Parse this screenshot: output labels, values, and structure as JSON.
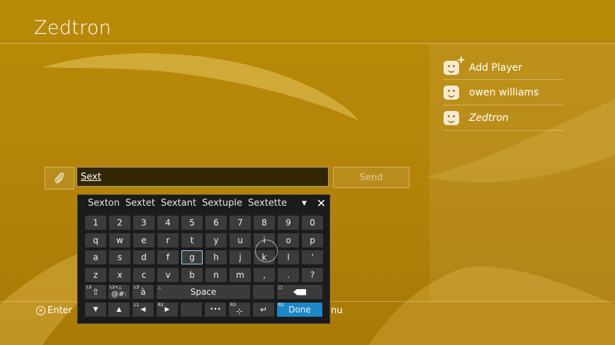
{
  "header": {
    "title": "Zedtron"
  },
  "players": [
    {
      "label": "Add Player",
      "icon": "add-player-icon",
      "italic": false
    },
    {
      "label": "owen williams",
      "icon": "user-face-icon",
      "italic": false
    },
    {
      "label": "Zedtron",
      "icon": "user-face-icon",
      "italic": true
    }
  ],
  "compose": {
    "input_value": "Sext",
    "send_label": "Send",
    "attach_icon": "paperclip-icon"
  },
  "hints": {
    "enter_label": "Enter",
    "menu_label": "nu"
  },
  "keyboard": {
    "suggestions": [
      "Sexton",
      "Sextet",
      "Sextant",
      "Sextuple",
      "Sextette"
    ],
    "rows": [
      [
        "1",
        "2",
        "3",
        "4",
        "5",
        "6",
        "7",
        "8",
        "9",
        "0"
      ],
      [
        "q",
        "w",
        "e",
        "r",
        "t",
        "y",
        "u",
        "i",
        "o",
        "p"
      ],
      [
        "a",
        "s",
        "d",
        "f",
        "g",
        "h",
        "j",
        "k",
        "l",
        "'"
      ],
      [
        "z",
        "x",
        "c",
        "v",
        "b",
        "n",
        "m",
        ",",
        ".",
        "?"
      ]
    ],
    "selected_key": "g",
    "shift_tag": "L2",
    "symbols_tag": "L2+△",
    "symbols_label": "@#:",
    "accent_tag": "L3",
    "accent_label": "à",
    "space_tag": "△",
    "space_label": "Space",
    "backspace_tag": "□",
    "left_tag": "L1",
    "right_tag": "R1",
    "more_label": "•••",
    "pointer_tag": "R3",
    "done_tag": "R2",
    "done_label": "Done"
  },
  "colors": {
    "accent": "#1e86c9",
    "background": "#b5850a"
  }
}
